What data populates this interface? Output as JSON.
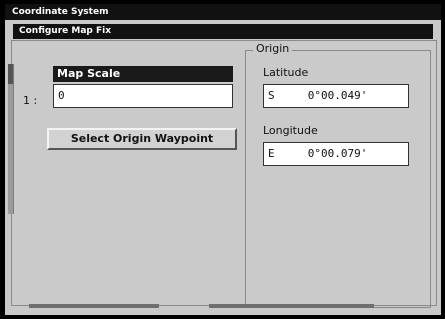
{
  "window": {
    "title": "Coordinate System",
    "subtitle": "Configure Map Fix"
  },
  "map_scale": {
    "label": "Map Scale",
    "ratio_prefix": "1 :",
    "value": "0"
  },
  "select_origin_button": {
    "label": "Select Origin Waypoint"
  },
  "origin": {
    "caption": "Origin",
    "latitude": {
      "label": "Latitude",
      "value": "S     0°00.049'"
    },
    "longitude": {
      "label": "Longitude",
      "value": "E     0°00.079'"
    }
  }
}
